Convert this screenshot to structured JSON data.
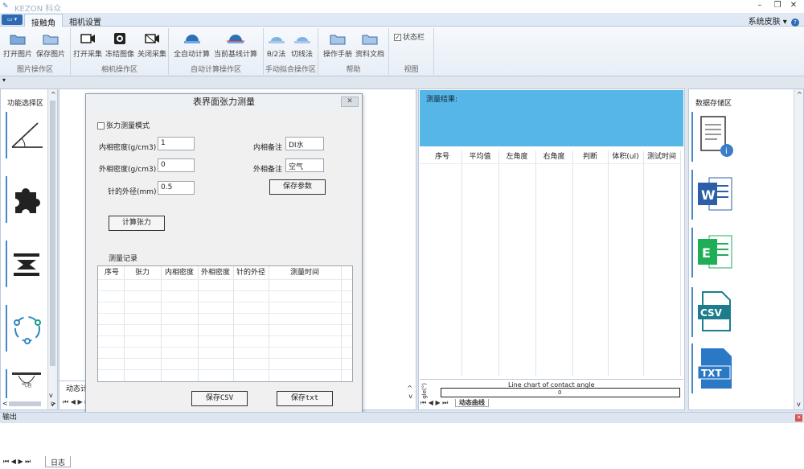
{
  "window": {
    "title": "KEZON 科众",
    "minimize": "–",
    "restore": "❐",
    "close": "✕"
  },
  "menu": {
    "tabs": [
      {
        "label": "接触角",
        "active": true
      },
      {
        "label": "相机设置",
        "active": false
      }
    ],
    "skin_label": "系统皮肤",
    "skin_arrow": "▾"
  },
  "ribbon": {
    "groups": [
      {
        "label": "图片操作区",
        "buttons": [
          "打开图片",
          "保存图片"
        ]
      },
      {
        "label": "相机操作区",
        "buttons": [
          "打开采集",
          "冻结图像",
          "关闭采集"
        ]
      },
      {
        "label": "自动计算操作区",
        "buttons": [
          "全自动计算",
          "当前基线计算"
        ]
      },
      {
        "label": "手动拟合操作区",
        "buttons": [
          "θ/2法",
          "切线法"
        ]
      },
      {
        "label": "帮助",
        "buttons": [
          "操作手册",
          "资料文档"
        ]
      },
      {
        "label": "视图",
        "checkbox": "状态栏",
        "checked": true
      }
    ]
  },
  "left_panel": {
    "title": "功能选择区"
  },
  "center": {
    "tab_label": "动态计",
    "nav": "⏮ ◀ ▶ ⏭"
  },
  "results": {
    "title": "测量结果:",
    "columns": [
      "序号",
      "平均值",
      "左角度",
      "右角度",
      "判断",
      "体积(ul)",
      "测试时间"
    ],
    "chart_title": "Line chart of contact angle",
    "chart_axis": "gle(°)",
    "chart_value": "0",
    "tab_label": "动态曲线"
  },
  "data_panel": {
    "title": "数据存储区"
  },
  "dialog": {
    "title": "表界面张力测量",
    "close": "✕",
    "mode_checkbox": "张力测量模式",
    "fields": {
      "inner_density_label": "内相密度(g/cm3)",
      "inner_density_value": "1",
      "outer_density_label": "外相密度(g/cm3)",
      "outer_density_value": "0",
      "needle_label": "针的外径(mm)",
      "needle_value": "0.5",
      "inner_note_label": "内相备注",
      "inner_note_value": "DI水",
      "outer_note_label": "外相备注",
      "outer_note_value": "空气"
    },
    "save_params": "保存参数",
    "calc_tension": "计算张力",
    "records_label": "测量记录",
    "record_columns": [
      "序号",
      "张力",
      "内相密度",
      "外相密度",
      "针的外径",
      "测量时间"
    ],
    "save_csv": "保存CSV",
    "save_txt": "保存txt"
  },
  "output": {
    "title": "输出",
    "log_tab": "日志",
    "nav": "⏮ ◀ ▶ ⏭"
  },
  "colors": {
    "result_bg": "#56b6e8",
    "accent": "#2f6bb5",
    "excel": "#1fae58",
    "word": "#2c5fa8",
    "csv": "#1d7d8d",
    "txt": "#2b78c5"
  },
  "icons": {
    "qat": "▾",
    "scroll_up": "^",
    "scroll_down": "v",
    "scroll_left": "<",
    "scroll_right": ">"
  }
}
